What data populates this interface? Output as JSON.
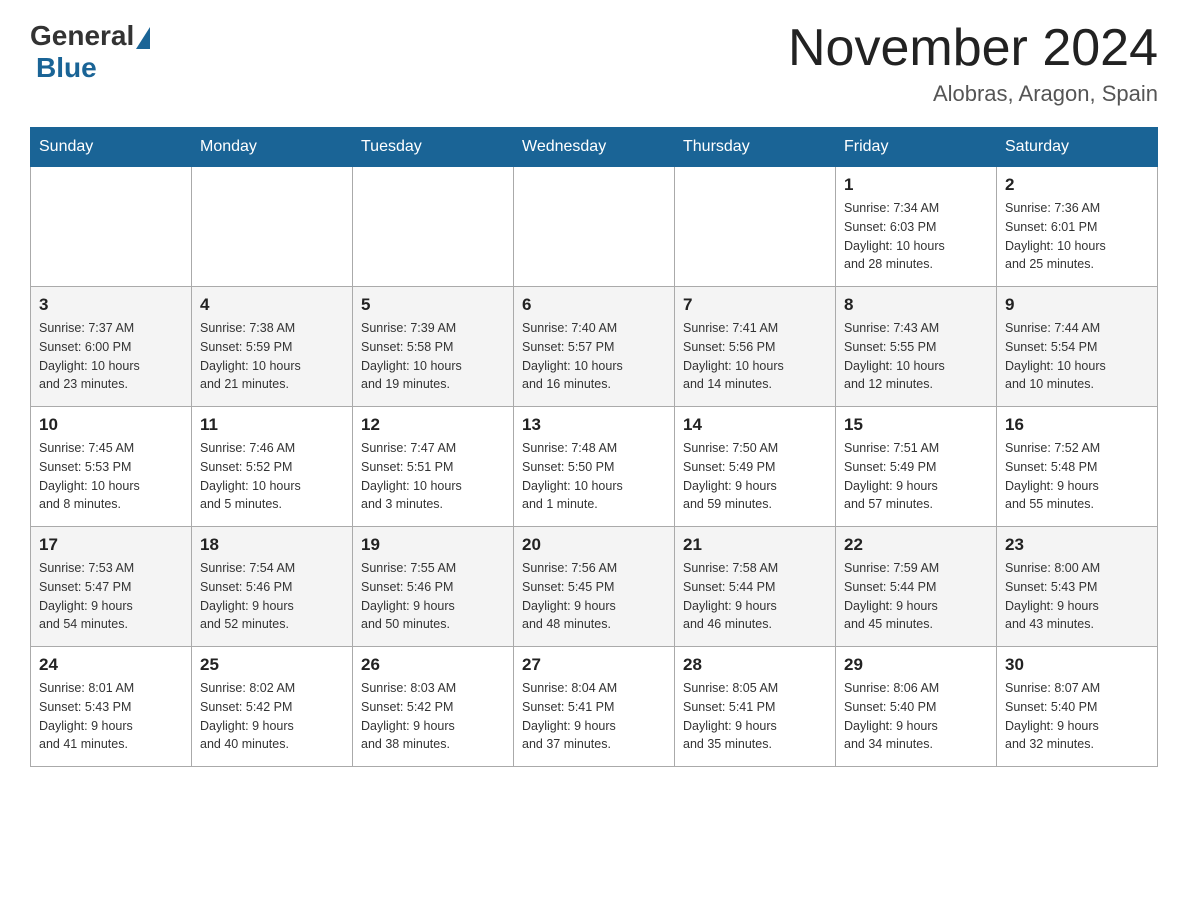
{
  "header": {
    "logo_general": "General",
    "logo_blue": "Blue",
    "month_title": "November 2024",
    "location": "Alobras, Aragon, Spain"
  },
  "days_of_week": [
    "Sunday",
    "Monday",
    "Tuesday",
    "Wednesday",
    "Thursday",
    "Friday",
    "Saturday"
  ],
  "weeks": [
    [
      {
        "day": "",
        "info": ""
      },
      {
        "day": "",
        "info": ""
      },
      {
        "day": "",
        "info": ""
      },
      {
        "day": "",
        "info": ""
      },
      {
        "day": "",
        "info": ""
      },
      {
        "day": "1",
        "info": "Sunrise: 7:34 AM\nSunset: 6:03 PM\nDaylight: 10 hours\nand 28 minutes."
      },
      {
        "day": "2",
        "info": "Sunrise: 7:36 AM\nSunset: 6:01 PM\nDaylight: 10 hours\nand 25 minutes."
      }
    ],
    [
      {
        "day": "3",
        "info": "Sunrise: 7:37 AM\nSunset: 6:00 PM\nDaylight: 10 hours\nand 23 minutes."
      },
      {
        "day": "4",
        "info": "Sunrise: 7:38 AM\nSunset: 5:59 PM\nDaylight: 10 hours\nand 21 minutes."
      },
      {
        "day": "5",
        "info": "Sunrise: 7:39 AM\nSunset: 5:58 PM\nDaylight: 10 hours\nand 19 minutes."
      },
      {
        "day": "6",
        "info": "Sunrise: 7:40 AM\nSunset: 5:57 PM\nDaylight: 10 hours\nand 16 minutes."
      },
      {
        "day": "7",
        "info": "Sunrise: 7:41 AM\nSunset: 5:56 PM\nDaylight: 10 hours\nand 14 minutes."
      },
      {
        "day": "8",
        "info": "Sunrise: 7:43 AM\nSunset: 5:55 PM\nDaylight: 10 hours\nand 12 minutes."
      },
      {
        "day": "9",
        "info": "Sunrise: 7:44 AM\nSunset: 5:54 PM\nDaylight: 10 hours\nand 10 minutes."
      }
    ],
    [
      {
        "day": "10",
        "info": "Sunrise: 7:45 AM\nSunset: 5:53 PM\nDaylight: 10 hours\nand 8 minutes."
      },
      {
        "day": "11",
        "info": "Sunrise: 7:46 AM\nSunset: 5:52 PM\nDaylight: 10 hours\nand 5 minutes."
      },
      {
        "day": "12",
        "info": "Sunrise: 7:47 AM\nSunset: 5:51 PM\nDaylight: 10 hours\nand 3 minutes."
      },
      {
        "day": "13",
        "info": "Sunrise: 7:48 AM\nSunset: 5:50 PM\nDaylight: 10 hours\nand 1 minute."
      },
      {
        "day": "14",
        "info": "Sunrise: 7:50 AM\nSunset: 5:49 PM\nDaylight: 9 hours\nand 59 minutes."
      },
      {
        "day": "15",
        "info": "Sunrise: 7:51 AM\nSunset: 5:49 PM\nDaylight: 9 hours\nand 57 minutes."
      },
      {
        "day": "16",
        "info": "Sunrise: 7:52 AM\nSunset: 5:48 PM\nDaylight: 9 hours\nand 55 minutes."
      }
    ],
    [
      {
        "day": "17",
        "info": "Sunrise: 7:53 AM\nSunset: 5:47 PM\nDaylight: 9 hours\nand 54 minutes."
      },
      {
        "day": "18",
        "info": "Sunrise: 7:54 AM\nSunset: 5:46 PM\nDaylight: 9 hours\nand 52 minutes."
      },
      {
        "day": "19",
        "info": "Sunrise: 7:55 AM\nSunset: 5:46 PM\nDaylight: 9 hours\nand 50 minutes."
      },
      {
        "day": "20",
        "info": "Sunrise: 7:56 AM\nSunset: 5:45 PM\nDaylight: 9 hours\nand 48 minutes."
      },
      {
        "day": "21",
        "info": "Sunrise: 7:58 AM\nSunset: 5:44 PM\nDaylight: 9 hours\nand 46 minutes."
      },
      {
        "day": "22",
        "info": "Sunrise: 7:59 AM\nSunset: 5:44 PM\nDaylight: 9 hours\nand 45 minutes."
      },
      {
        "day": "23",
        "info": "Sunrise: 8:00 AM\nSunset: 5:43 PM\nDaylight: 9 hours\nand 43 minutes."
      }
    ],
    [
      {
        "day": "24",
        "info": "Sunrise: 8:01 AM\nSunset: 5:43 PM\nDaylight: 9 hours\nand 41 minutes."
      },
      {
        "day": "25",
        "info": "Sunrise: 8:02 AM\nSunset: 5:42 PM\nDaylight: 9 hours\nand 40 minutes."
      },
      {
        "day": "26",
        "info": "Sunrise: 8:03 AM\nSunset: 5:42 PM\nDaylight: 9 hours\nand 38 minutes."
      },
      {
        "day": "27",
        "info": "Sunrise: 8:04 AM\nSunset: 5:41 PM\nDaylight: 9 hours\nand 37 minutes."
      },
      {
        "day": "28",
        "info": "Sunrise: 8:05 AM\nSunset: 5:41 PM\nDaylight: 9 hours\nand 35 minutes."
      },
      {
        "day": "29",
        "info": "Sunrise: 8:06 AM\nSunset: 5:40 PM\nDaylight: 9 hours\nand 34 minutes."
      },
      {
        "day": "30",
        "info": "Sunrise: 8:07 AM\nSunset: 5:40 PM\nDaylight: 9 hours\nand 32 minutes."
      }
    ]
  ]
}
